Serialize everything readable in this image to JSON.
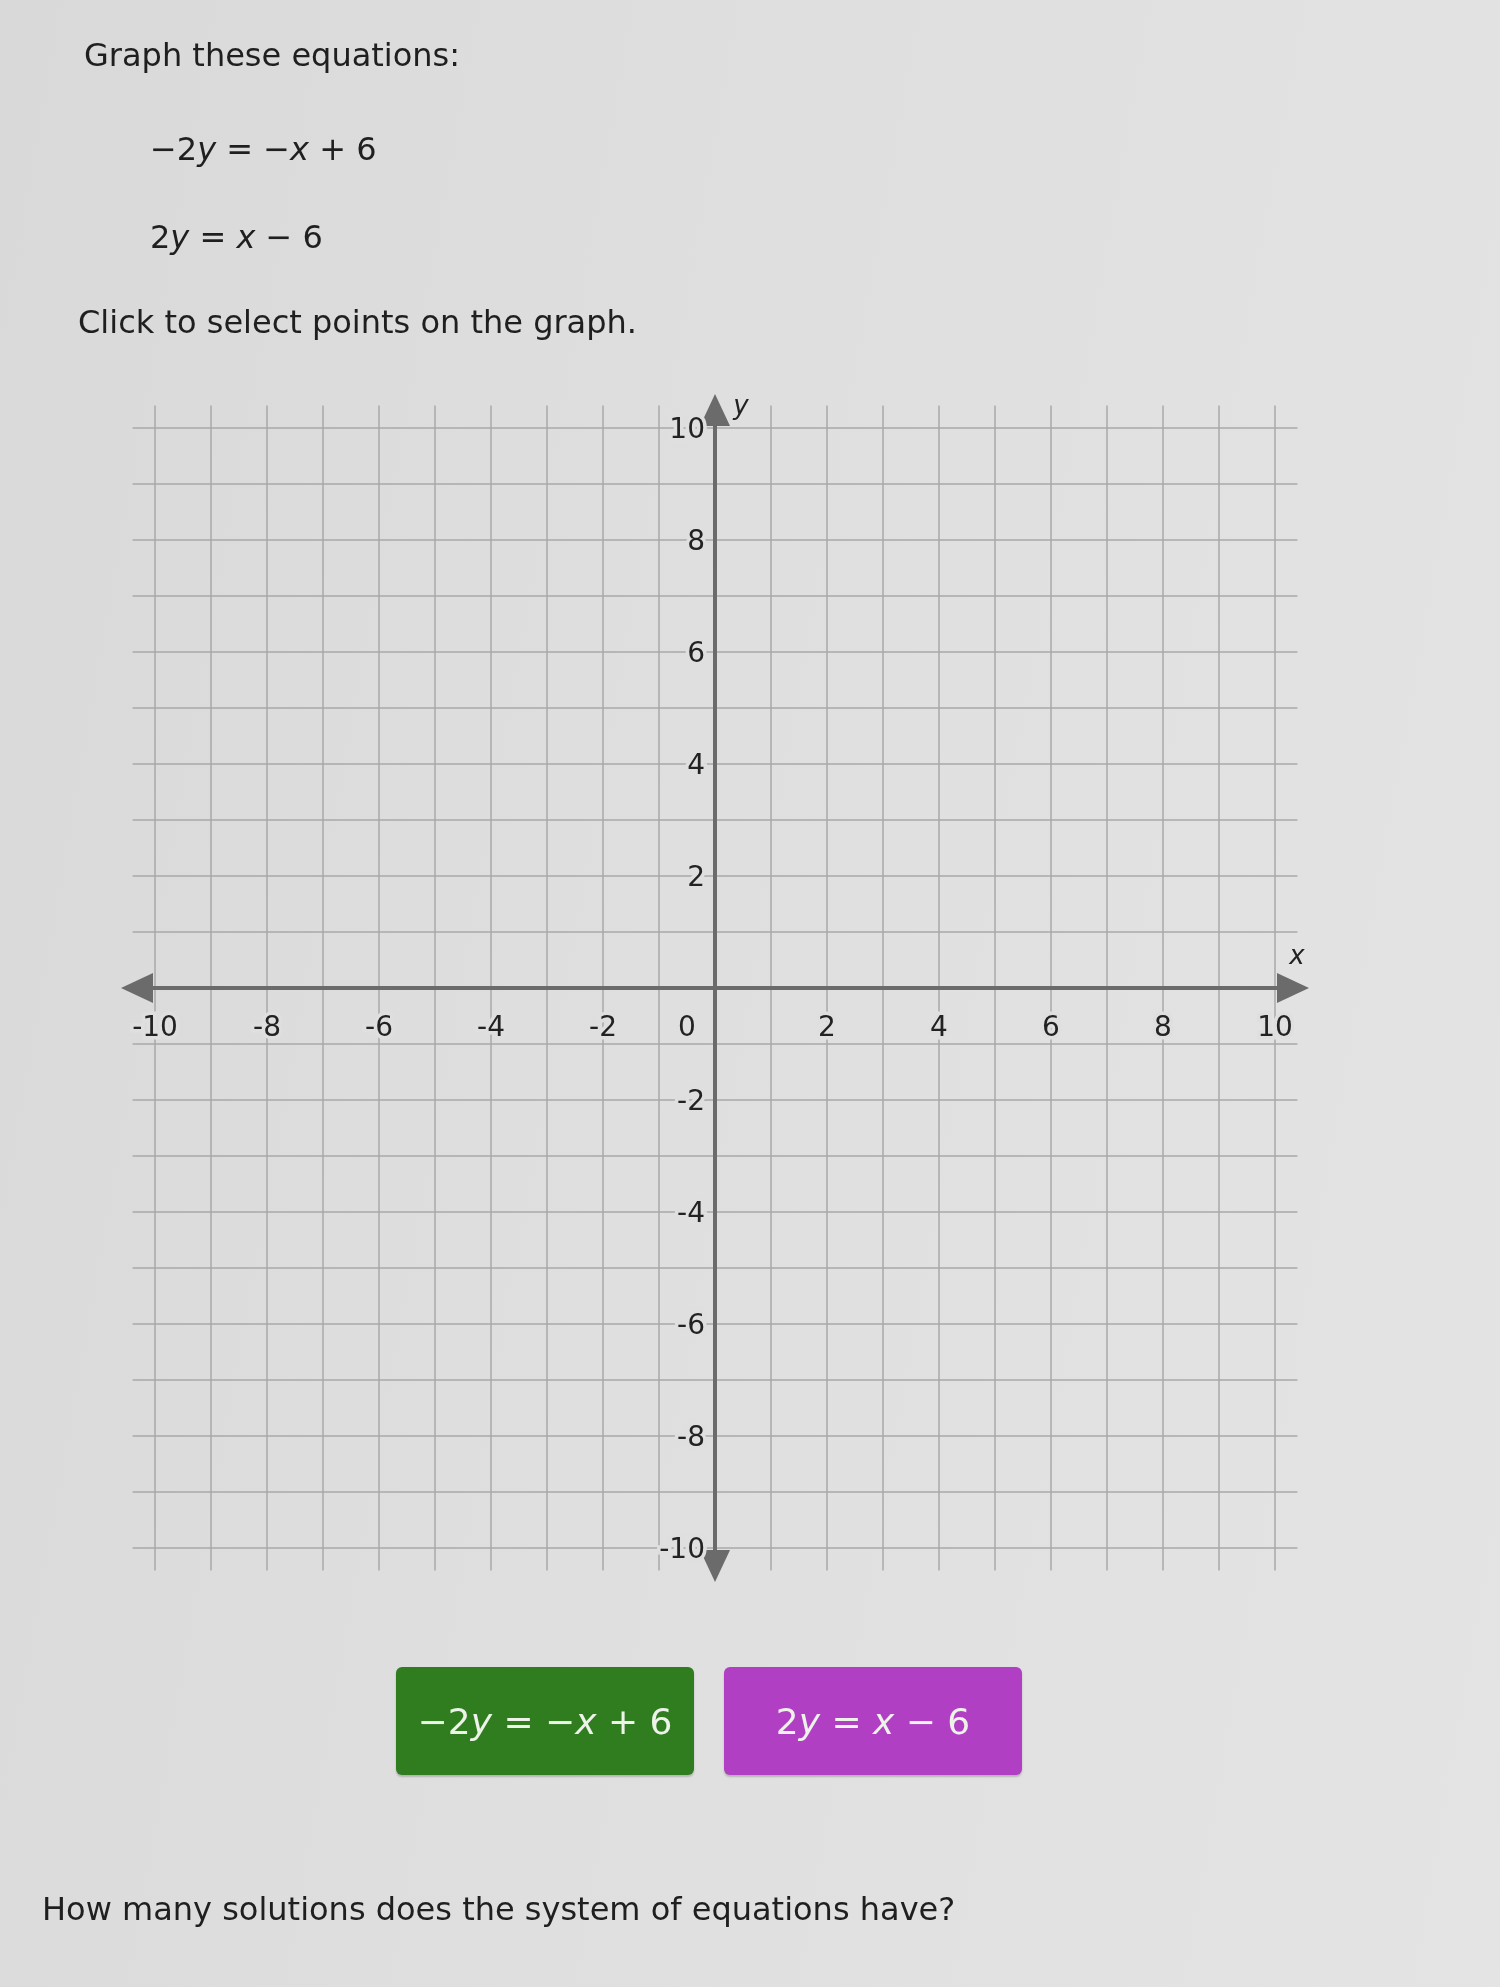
{
  "prompt": {
    "title": "Graph these equations:",
    "equations": [
      [
        {
          "kind": "plain",
          "text": "−2"
        },
        {
          "kind": "variable",
          "text": "y"
        },
        {
          "kind": "plain",
          "text": " = −"
        },
        {
          "kind": "variable",
          "text": "x"
        },
        {
          "kind": "plain",
          "text": " + 6"
        }
      ],
      [
        {
          "kind": "plain",
          "text": "2"
        },
        {
          "kind": "variable",
          "text": "y"
        },
        {
          "kind": "plain",
          "text": " = "
        },
        {
          "kind": "variable",
          "text": "x"
        },
        {
          "kind": "plain",
          "text": " − 6"
        }
      ]
    ],
    "instruction": "Click to select points on the graph."
  },
  "graph": {
    "x_axis_label": "x",
    "y_axis_label": "y",
    "origin_label": "0",
    "x_ticks": [
      "-10",
      "-8",
      "-6",
      "-4",
      "-2",
      "2",
      "4",
      "6",
      "8",
      "10"
    ],
    "y_ticks": [
      "10",
      "8",
      "6",
      "4",
      "2",
      "-2",
      "-4",
      "-6",
      "-8",
      "-10"
    ]
  },
  "line_buttons": [
    {
      "label": [
        {
          "kind": "plain",
          "text": "−2"
        },
        {
          "kind": "variable",
          "text": "y"
        },
        {
          "kind": "plain",
          "text": " = −"
        },
        {
          "kind": "variable",
          "text": "x"
        },
        {
          "kind": "plain",
          "text": " + 6"
        }
      ],
      "color": "#2f7d1f"
    },
    {
      "label": [
        {
          "kind": "plain",
          "text": "2"
        },
        {
          "kind": "variable",
          "text": "y"
        },
        {
          "kind": "plain",
          "text": " = "
        },
        {
          "kind": "variable",
          "text": "x"
        },
        {
          "kind": "plain",
          "text": " − 6"
        }
      ],
      "color": "#b13fc4"
    }
  ],
  "question": "How many solutions does the system of equations have?"
}
